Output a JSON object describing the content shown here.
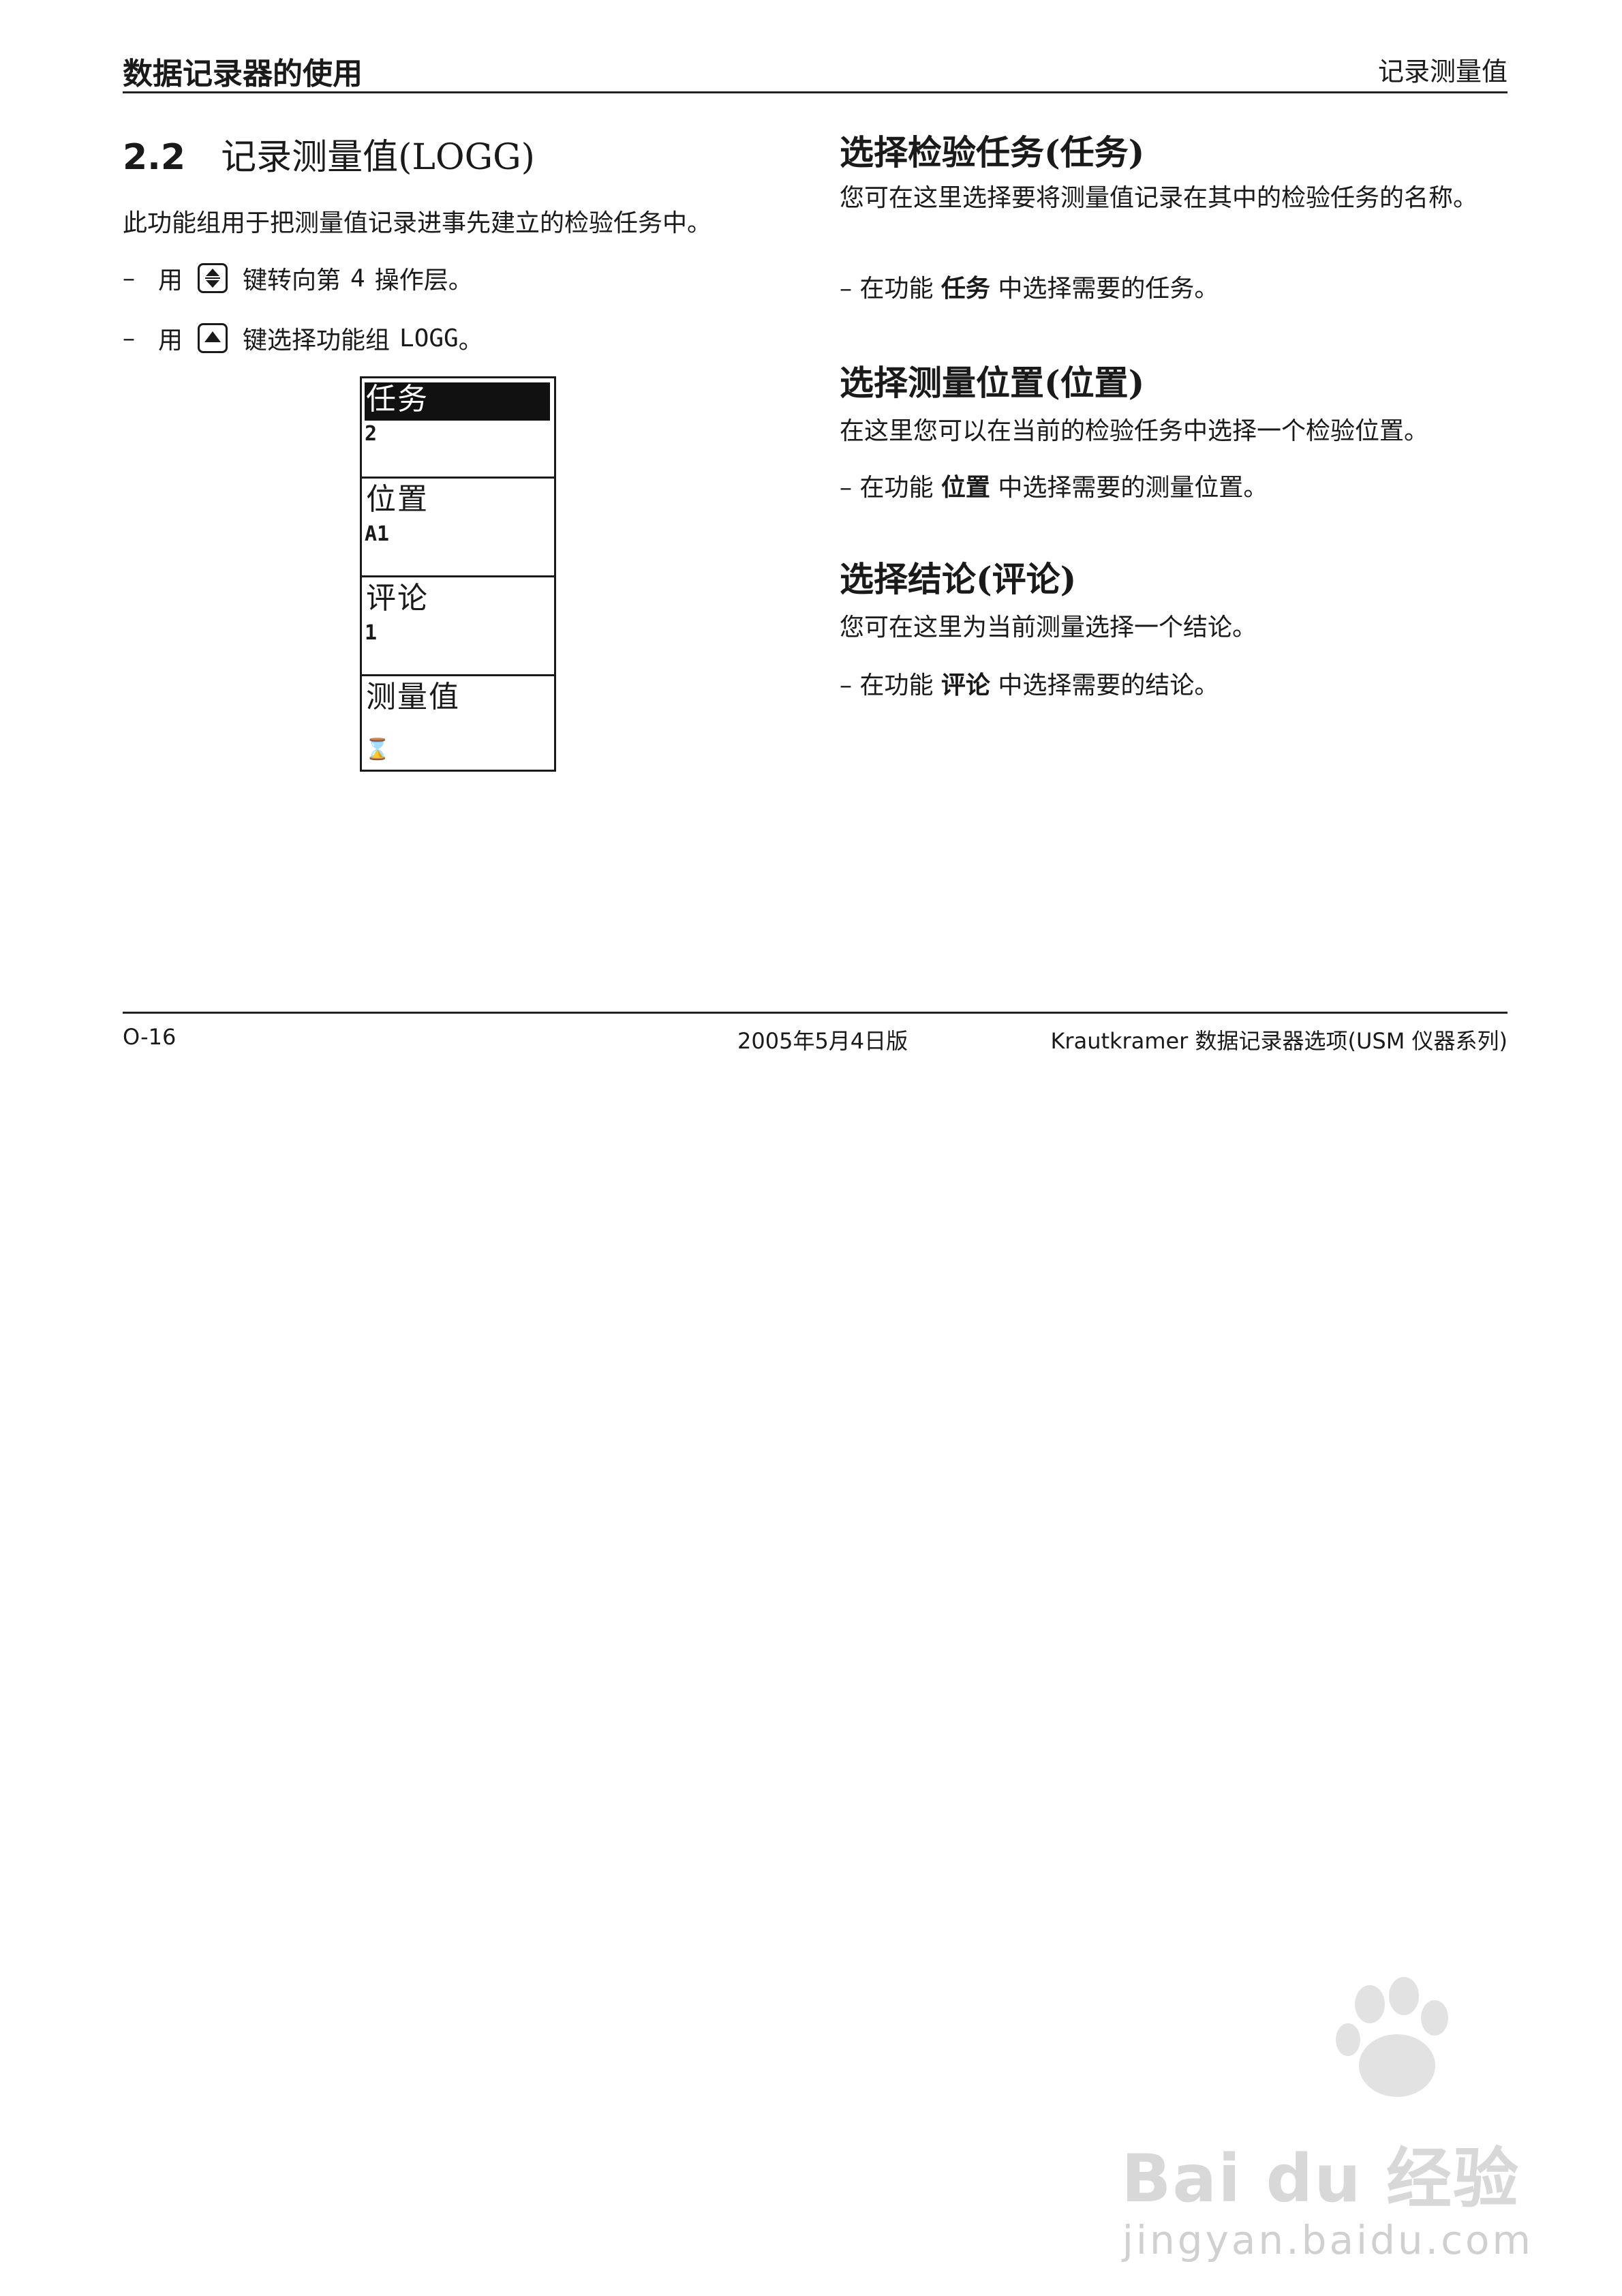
{
  "header": {
    "left": "数据记录器的使用",
    "right": "记录测量值"
  },
  "section": {
    "number": "2.2",
    "title": "记录测量值(LOGG)",
    "intro": "此功能组用于把测量值记录进事先建立的检验任务中。",
    "step1": {
      "dash": "–",
      "pre": "用",
      "key_icon": "up-down-arrow-key-icon",
      "post": "键转向第",
      "num": "4",
      "tail": "操作层。"
    },
    "step2": {
      "dash": "–",
      "pre": "用",
      "key_icon": "up-arrow-key-icon",
      "post": "键选择功能组",
      "code": "LOGG",
      "tail": "。"
    }
  },
  "menu": {
    "cells": [
      {
        "label": "任务",
        "value": "2",
        "active": true
      },
      {
        "label": "位置",
        "value": "A1",
        "active": false
      },
      {
        "label": "评论",
        "value": "1",
        "active": false
      },
      {
        "label": "测量值",
        "value": "⌛",
        "active": false
      }
    ]
  },
  "right": {
    "task": {
      "heading": "选择检验任务(任务)",
      "body": "您可在这里选择要将测量值记录在其中的检验任务的名称。",
      "step_pre": "– 在功能",
      "step_bold": "任务",
      "step_post": "中选择需要的任务。"
    },
    "position": {
      "heading": "选择测量位置(位置)",
      "body": "在这里您可以在当前的检验任务中选择一个检验位置。",
      "step_pre": "– 在功能",
      "step_bold": "位置",
      "step_post": "中选择需要的测量位置。"
    },
    "comment": {
      "heading": "选择结论(评论)",
      "body": "您可在这里为当前测量选择一个结论。",
      "step_pre": "– 在功能",
      "step_bold": "评论",
      "step_post": "中选择需要的结论。"
    }
  },
  "footer": {
    "page": "O-16",
    "edition": "2005年5月4日版",
    "product": "Krautkramer 数据记录器选项(USM 仪器系列)"
  },
  "watermark": {
    "logo": "Bai du 经验",
    "url": "jingyan.baidu.com"
  }
}
